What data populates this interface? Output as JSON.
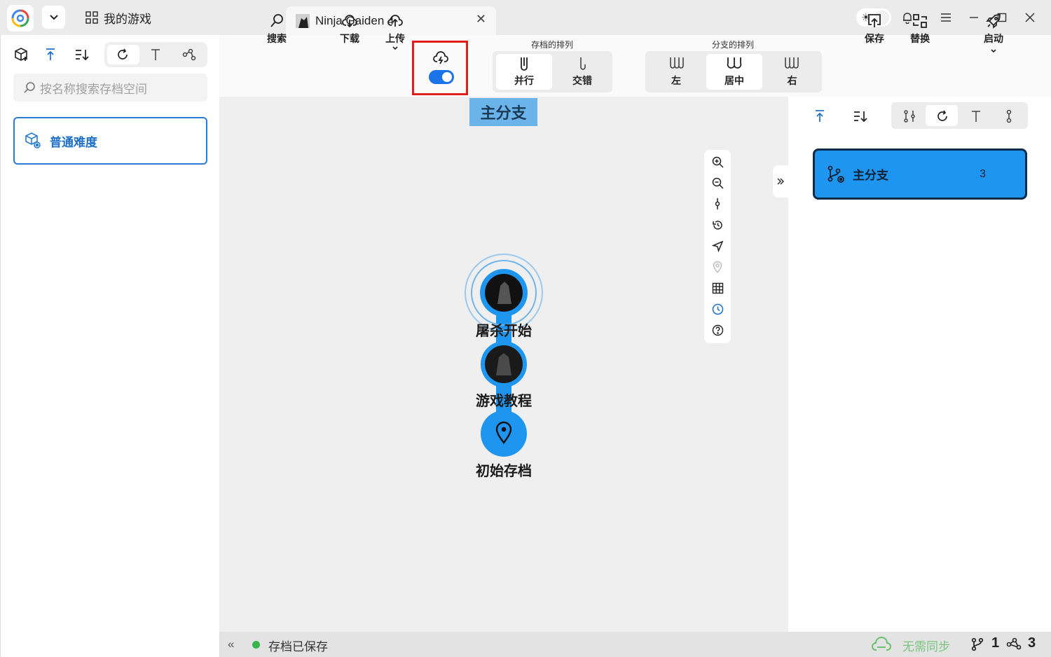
{
  "titlebar": {
    "my_games_label": "我的游戏",
    "tab_title": "Ninja Gaiden 4",
    "close_symbol": "✕"
  },
  "left": {
    "search_placeholder": "按名称搜索存档空间",
    "workspace_name": "普通难度"
  },
  "toolbar": {
    "search": "搜索",
    "download": "下载",
    "upload": "上传",
    "save_order_label": "存档的排列",
    "parallel": "并行",
    "interleave": "交错",
    "branch_order_label": "分支的排列",
    "left_align": "左",
    "center_align": "居中",
    "right_align": "右",
    "save": "保存",
    "replace": "替换",
    "launch": "启动"
  },
  "graph": {
    "branch_title": "主分支",
    "nodes": [
      {
        "label": "屠杀开始"
      },
      {
        "label": "游戏教程"
      },
      {
        "label": "初始存档"
      }
    ]
  },
  "right": {
    "branch_name": "主分支",
    "branch_count": "3"
  },
  "status": {
    "collapse_symbol": "«",
    "saved_text": "存档已保存",
    "sync_text": "无需同步",
    "branch_count": "1",
    "node_count": "3"
  },
  "colors": {
    "accent": "#1e96f0",
    "highlight": "#e21b1b",
    "saved_dot": "#38b449"
  }
}
